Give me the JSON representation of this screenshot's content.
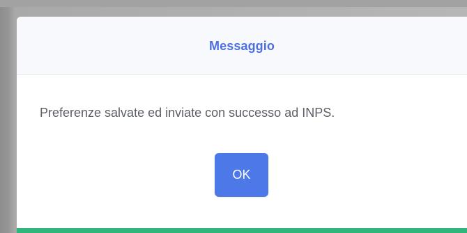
{
  "dialog": {
    "title": "Messaggio",
    "message": "Preferenze salvate ed inviate con successo ad INPS.",
    "ok_label": "OK"
  },
  "colors": {
    "title_text": "#4d6fe0",
    "message_text": "#5b5f66",
    "primary_button": "#4d78e8",
    "header_background": "#f7f9fc",
    "accent_bar": "#2fb77b"
  }
}
